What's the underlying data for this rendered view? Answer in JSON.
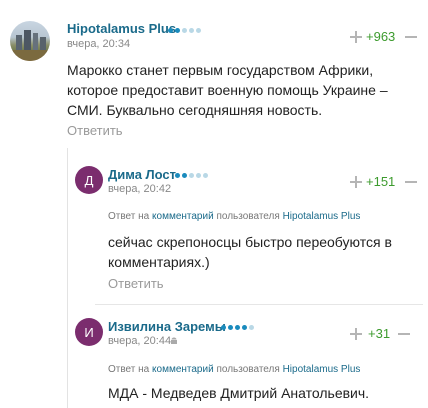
{
  "comments": [
    {
      "username": "Hipotalamus Plus",
      "date": "вчера, 20:34",
      "rating": "+963",
      "text": "Марокко станет первым государством Африки, которое предоставит военную помощь Украине – СМИ. Буквально сегодняшняя новость.",
      "reply_label": "Ответить",
      "rank_dots": [
        true,
        true,
        false,
        false,
        false
      ]
    },
    {
      "username": "Дима Лост",
      "avatar_letter": "Д",
      "date": "вчера, 20:42",
      "rating": "+151",
      "reply_to": {
        "prefix": "Ответ на",
        "comment_link": "комментарий",
        "middle": "пользователя",
        "user_link": "Hipotalamus Plus"
      },
      "text": "сейчас скрепоносцы быстро переобуются в комментариях.)",
      "reply_label": "Ответить",
      "rank_dots": [
        true,
        true,
        false,
        false,
        false
      ]
    },
    {
      "username": "Извилина Заремы",
      "avatar_letter": "И",
      "date": "вчера, 20:44",
      "rating": "+31",
      "reply_to": {
        "prefix": "Ответ на",
        "comment_link": "комментарий",
        "middle": "пользователя",
        "user_link": "Hipotalamus Plus"
      },
      "text": "МДА - Медведев Дмитрий Анатольевич.",
      "rank_dots": [
        true,
        true,
        true,
        true,
        false
      ]
    }
  ],
  "colors": {
    "username": "#1a6a8a",
    "rating_positive": "#3d9b2e",
    "avatar_bg": "#7b2d6e",
    "rank_dot_on": "#1a8bbd"
  }
}
